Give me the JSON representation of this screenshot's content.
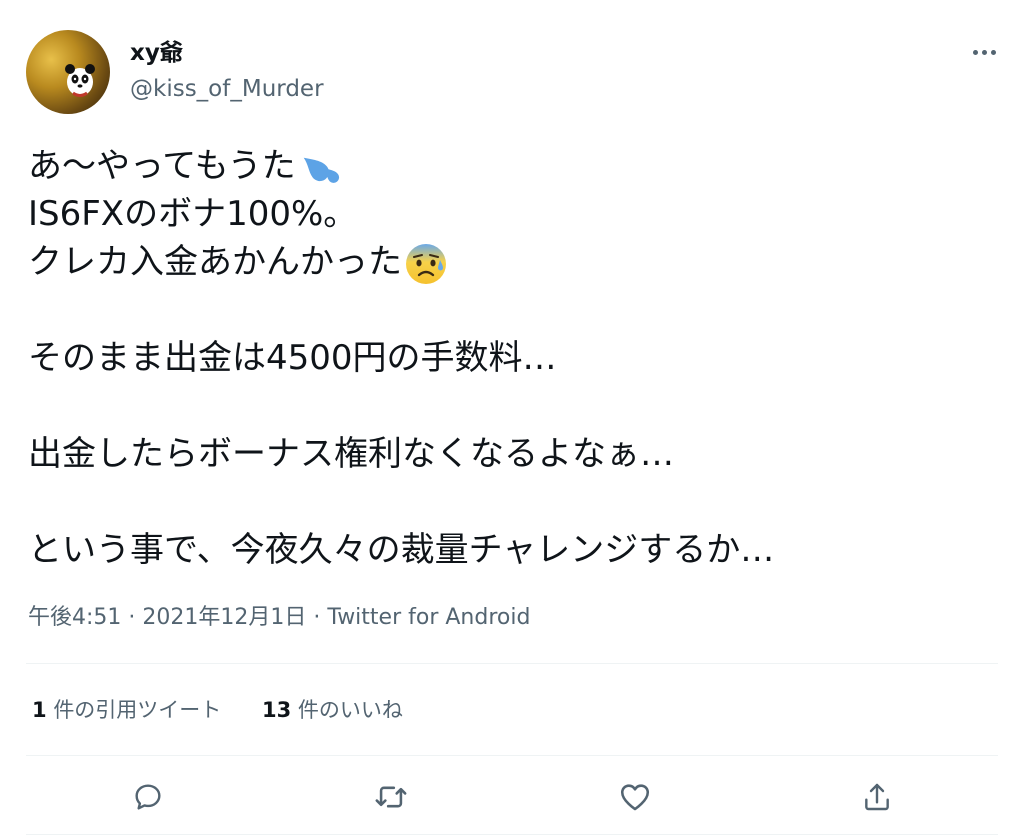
{
  "user": {
    "display_name": "xy爺",
    "handle": "@kiss_of_Murder"
  },
  "tweet": {
    "line1": "あ〜やってもうた",
    "line2": "IS6FXのボナ100%。",
    "line3": "クレカ入金あかんかった",
    "line4": "そのまま出金は4500円の手数料…",
    "line5": "出金したらボーナス権利なくなるよなぁ…",
    "line6": "という事で、今夜久々の裁量チャレンジするか…"
  },
  "meta": {
    "time": "午後4:51",
    "separator": "·",
    "date": "2021年12月1日",
    "source": "Twitter for Android"
  },
  "stats": {
    "quotes_count": "1",
    "quotes_label": "件の引用ツイート",
    "likes_count": "13",
    "likes_label": "件のいいね"
  },
  "icons": {
    "more": "more-horizontal-icon",
    "sweat_emoji": "sweat-droplets-emoji",
    "anxious_emoji": "anxious-face-emoji",
    "reply": "reply-icon",
    "retweet": "retweet-icon",
    "like": "heart-icon",
    "share": "share-icon"
  },
  "colors": {
    "text": "#0f1419",
    "secondary": "#536471",
    "divider": "#eff3f4"
  }
}
